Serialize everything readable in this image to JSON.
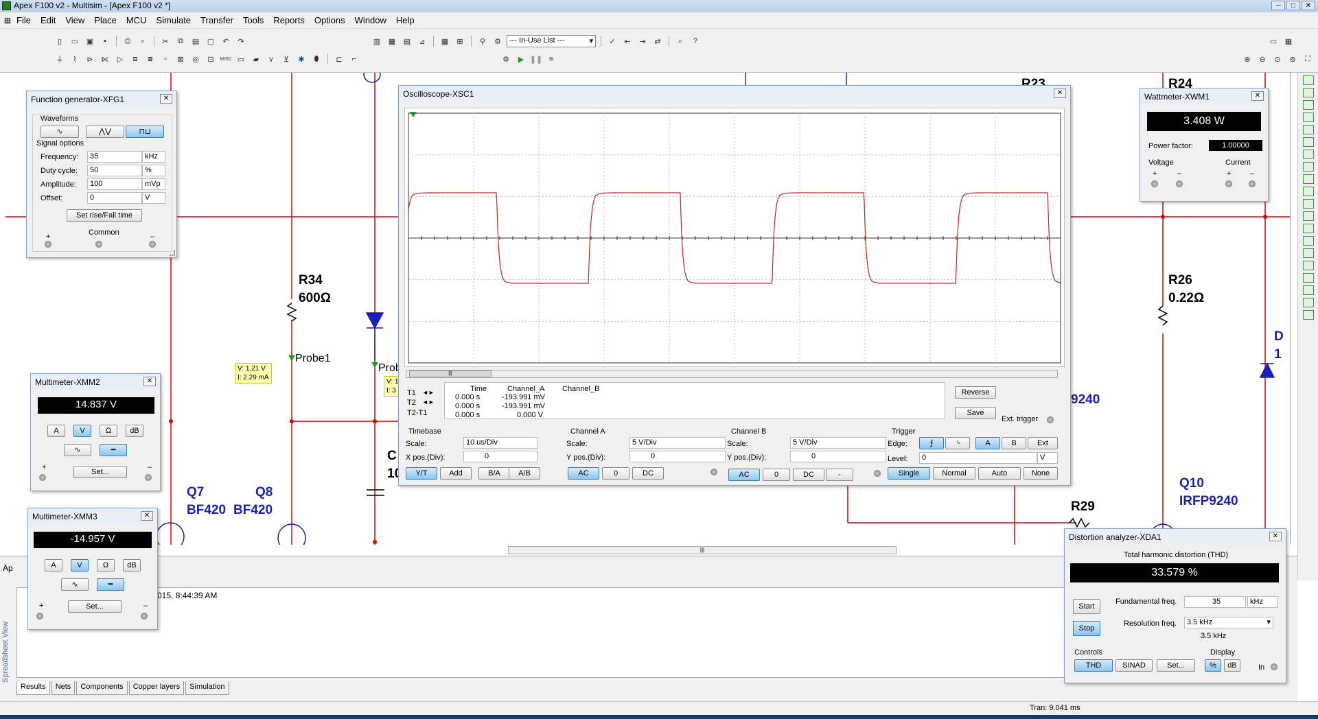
{
  "window": {
    "title": "Apex F100 v2 - Multisim - [Apex F100 v2 *]"
  },
  "menu": [
    "File",
    "Edit",
    "View",
    "Place",
    "MCU",
    "Simulate",
    "Transfer",
    "Tools",
    "Reports",
    "Options",
    "Window",
    "Help"
  ],
  "toolbar": {
    "inuse_list": "--- In-Use List ---"
  },
  "schematic": {
    "r34_name": "R34",
    "r34_value": "600Ω",
    "probe1": "Probe1",
    "probe1_values": [
      "V: 1.21 V",
      "I: 2.29 mA"
    ],
    "probe2": "Prob",
    "probe2_values": [
      "V: 1",
      "I: 3"
    ],
    "r26_name": "R26",
    "r26_value": "0.22Ω",
    "r24": "R24",
    "r23": "R23",
    "r29": "R29",
    "q7": "Q7",
    "q7_type": "BF420",
    "q8": "Q8",
    "q8_type": "BF420",
    "q10": "Q10",
    "q10_type": "IRFP9240",
    "part9240": "9240",
    "c_label": "C",
    "c_val": "10",
    "d_label": "D",
    "d_val": "1"
  },
  "fgen": {
    "title": "Function generator-XFG1",
    "waveforms": "Waveforms",
    "signal_options": "Signal options",
    "rows": [
      {
        "label": "Frequency:",
        "value": "35",
        "unit": "kHz"
      },
      {
        "label": "Duty cycle:",
        "value": "50",
        "unit": "%"
      },
      {
        "label": "Amplitude:",
        "value": "100",
        "unit": "mVp"
      },
      {
        "label": "Offset:",
        "value": "0",
        "unit": "V"
      }
    ],
    "set_rise": "Set rise/Fall time",
    "plus": "+",
    "common": "Common",
    "minus": "–"
  },
  "mm2": {
    "title": "Multimeter-XMM2",
    "reading": "14.837 V",
    "a": "A",
    "v": "V",
    "ohm": "Ω",
    "db": "dB",
    "set": "Set...",
    "plus": "+",
    "minus": "–"
  },
  "mm3": {
    "title": "Multimeter-XMM3",
    "reading": "-14.957 V",
    "a": "A",
    "v": "V",
    "ohm": "Ω",
    "db": "dB",
    "set": "Set...",
    "plus": "+",
    "minus": "–"
  },
  "scope": {
    "title": "Oscilloscope-XSC1",
    "cursor_rows": [
      {
        "name": "T1",
        "time": "0.000 s",
        "a": "-193.991 mV",
        "b": ""
      },
      {
        "name": "T2",
        "time": "0.000 s",
        "a": "-193.991 mV",
        "b": ""
      },
      {
        "name": "T2-T1",
        "time": "0.000 s",
        "a": "0.000 V",
        "b": ""
      }
    ],
    "headers": {
      "time": "Time",
      "a": "Channel_A",
      "b": "Channel_B"
    },
    "reverse": "Reverse",
    "save": "Save",
    "ext_trigger": "Ext. trigger",
    "timebase": {
      "title": "Timebase",
      "scale_label": "Scale:",
      "scale": "10 us/Div",
      "xpos_label": "X pos.(Div):",
      "xpos": "0",
      "btns": [
        "Y/T",
        "Add",
        "B/A",
        "A/B"
      ]
    },
    "cha": {
      "title": "Channel A",
      "scale_label": "Scale:",
      "scale": "5  V/Div",
      "ypos_label": "Y pos.(Div):",
      "ypos": "0",
      "btns": [
        "AC",
        "0",
        "DC"
      ]
    },
    "chb": {
      "title": "Channel B",
      "scale_label": "Scale:",
      "scale": "5  V/Div",
      "ypos_label": "Y pos.(Div):",
      "ypos": "0",
      "btns": [
        "AC",
        "0",
        "DC",
        "-"
      ]
    },
    "trigger": {
      "title": "Trigger",
      "edge_label": "Edge:",
      "level_label": "Level:",
      "level": "0",
      "level_unit": "V",
      "src": [
        "A",
        "B",
        "Ext"
      ],
      "modes": [
        "Single",
        "Normal",
        "Auto",
        "None"
      ]
    }
  },
  "wattmeter": {
    "title": "Wattmeter-XWM1",
    "reading": "3.408 W",
    "pf_label": "Power factor:",
    "pf": "1.00000",
    "voltage": "Voltage",
    "current": "Current",
    "plus": "+",
    "minus": "–"
  },
  "distortion": {
    "title": "Distortion analyzer-XDA1",
    "thd_title": "Total harmonic distortion (THD)",
    "reading": "33.579 %",
    "start": "Start",
    "stop": "Stop",
    "fund_label": "Fundamental freq.",
    "fund": "35",
    "fund_unit": "kHz",
    "res_label": "Resolution freq.",
    "res": "3.5 kHz",
    "res_echo": "3.5 kHz",
    "controls": "Controls",
    "display": "Display",
    "thd": "THD",
    "sinad": "SINAD",
    "set": "Set...",
    "pct": "%",
    "db": "dB",
    "in": "In"
  },
  "log": {
    "text": "015, 8:44:39 AM",
    "side": "Spreadsheet View",
    "tabs": [
      "Results",
      "Nets",
      "Components",
      "Copper layers",
      "Simulation"
    ]
  },
  "status": {
    "tran": "Tran: 9.041 ms",
    "ap": "Ap"
  }
}
